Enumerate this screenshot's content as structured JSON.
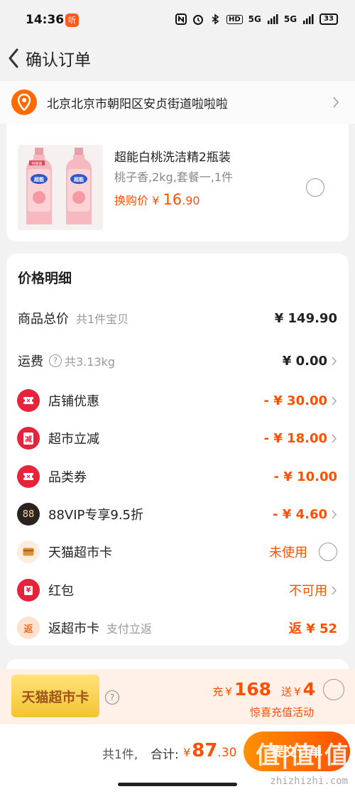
{
  "status": {
    "time": "14:36",
    "notif": "听",
    "hd": "HD",
    "net1": "5G",
    "net2": "5G",
    "battery": "33"
  },
  "header": {
    "title": "确认订单"
  },
  "address": {
    "text": "北京北京市朝阳区安贞街道啦啦啦"
  },
  "product": {
    "name": "超能白桃洗洁精2瓶装",
    "spec": "桃子香,2kg,套餐一,1件",
    "price_label": "换购价",
    "currency": "¥",
    "price_int": "16",
    "price_dec": ".90",
    "img_tag": "特惠装",
    "img_brand": "超能"
  },
  "details": {
    "title": "价格明细",
    "rows": [
      {
        "label": "商品总价",
        "sub": "共1件宝贝",
        "value": "¥ 149.90"
      },
      {
        "label": "运费",
        "sub": "共3.13kg",
        "value": "¥ 0.00"
      },
      {
        "label": "店铺优惠",
        "value": "- ¥ 30.00"
      },
      {
        "label": "超市立减",
        "value": "- ¥ 18.00",
        "icon_text": "减"
      },
      {
        "label": "品类券",
        "value": "- ¥ 10.00"
      },
      {
        "label": "88VIP专享9.5折",
        "value": "- ¥ 4.60",
        "icon_text": "88"
      },
      {
        "label": "天猫超市卡",
        "value": "未使用"
      },
      {
        "label": "红包",
        "value": "不可用",
        "icon_text": "¥"
      },
      {
        "label": "返超市卡",
        "sub": "支付立返",
        "value": "返 ¥ 52",
        "icon_text": "返"
      }
    ],
    "qmark": "?"
  },
  "recharge": {
    "card": "天猫超市卡",
    "q": "?",
    "charge": "充",
    "currency": "¥",
    "charge_amount": "168",
    "send": "送",
    "send_amount": "4",
    "sub": "惊喜充值活动"
  },
  "bottom": {
    "count": "共1件,",
    "total_label": "合计:",
    "currency": "¥",
    "total_int": "87",
    "total_dec": ".30",
    "submit": "提交订单"
  },
  "watermark": {
    "main": "值|值|值",
    "sub": "zhizhizhi.com"
  },
  "colors": {
    "accent": "#ff5000",
    "brand_orange": "#ff6b00",
    "bg": "#f2f2f2"
  }
}
